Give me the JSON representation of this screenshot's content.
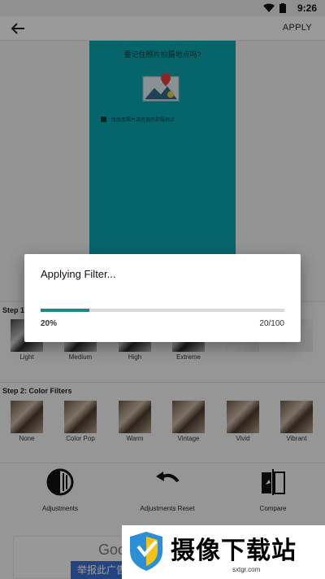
{
  "status": {
    "time": "9:26"
  },
  "toolbar": {
    "apply_label": "APPLY"
  },
  "preview": {
    "caption": "要记住照片拍摄地点吗?",
    "checkbox_text": "改改用照片浏览器的拍摄地点"
  },
  "step1": {
    "label": "Step 1",
    "items": [
      {
        "label": "Light"
      },
      {
        "label": "Medium"
      },
      {
        "label": "High"
      },
      {
        "label": "Extreme"
      },
      {
        "label": ""
      },
      {
        "label": ""
      }
    ]
  },
  "step2": {
    "label": "Step 2: Color Filters",
    "items": [
      {
        "label": "None"
      },
      {
        "label": "Color Pop"
      },
      {
        "label": "Warm"
      },
      {
        "label": "Vintage"
      },
      {
        "label": "Vivid"
      },
      {
        "label": "Vibrant"
      }
    ]
  },
  "bottom_bar": {
    "adjustments": "Adjustments",
    "adjustments_reset": "Adjustments Reset",
    "compare": "Compare"
  },
  "dialog": {
    "title": "Applying Filter...",
    "progress_percent": "20%",
    "progress_count": "20/100",
    "progress_value": 0.2,
    "accent_color": "#1c8a86"
  },
  "ad": {
    "brand_partial": "Goo",
    "button_label": "举报此广告"
  },
  "watermark": {
    "title": "摄像下载站",
    "url": "sxtgr.com"
  }
}
